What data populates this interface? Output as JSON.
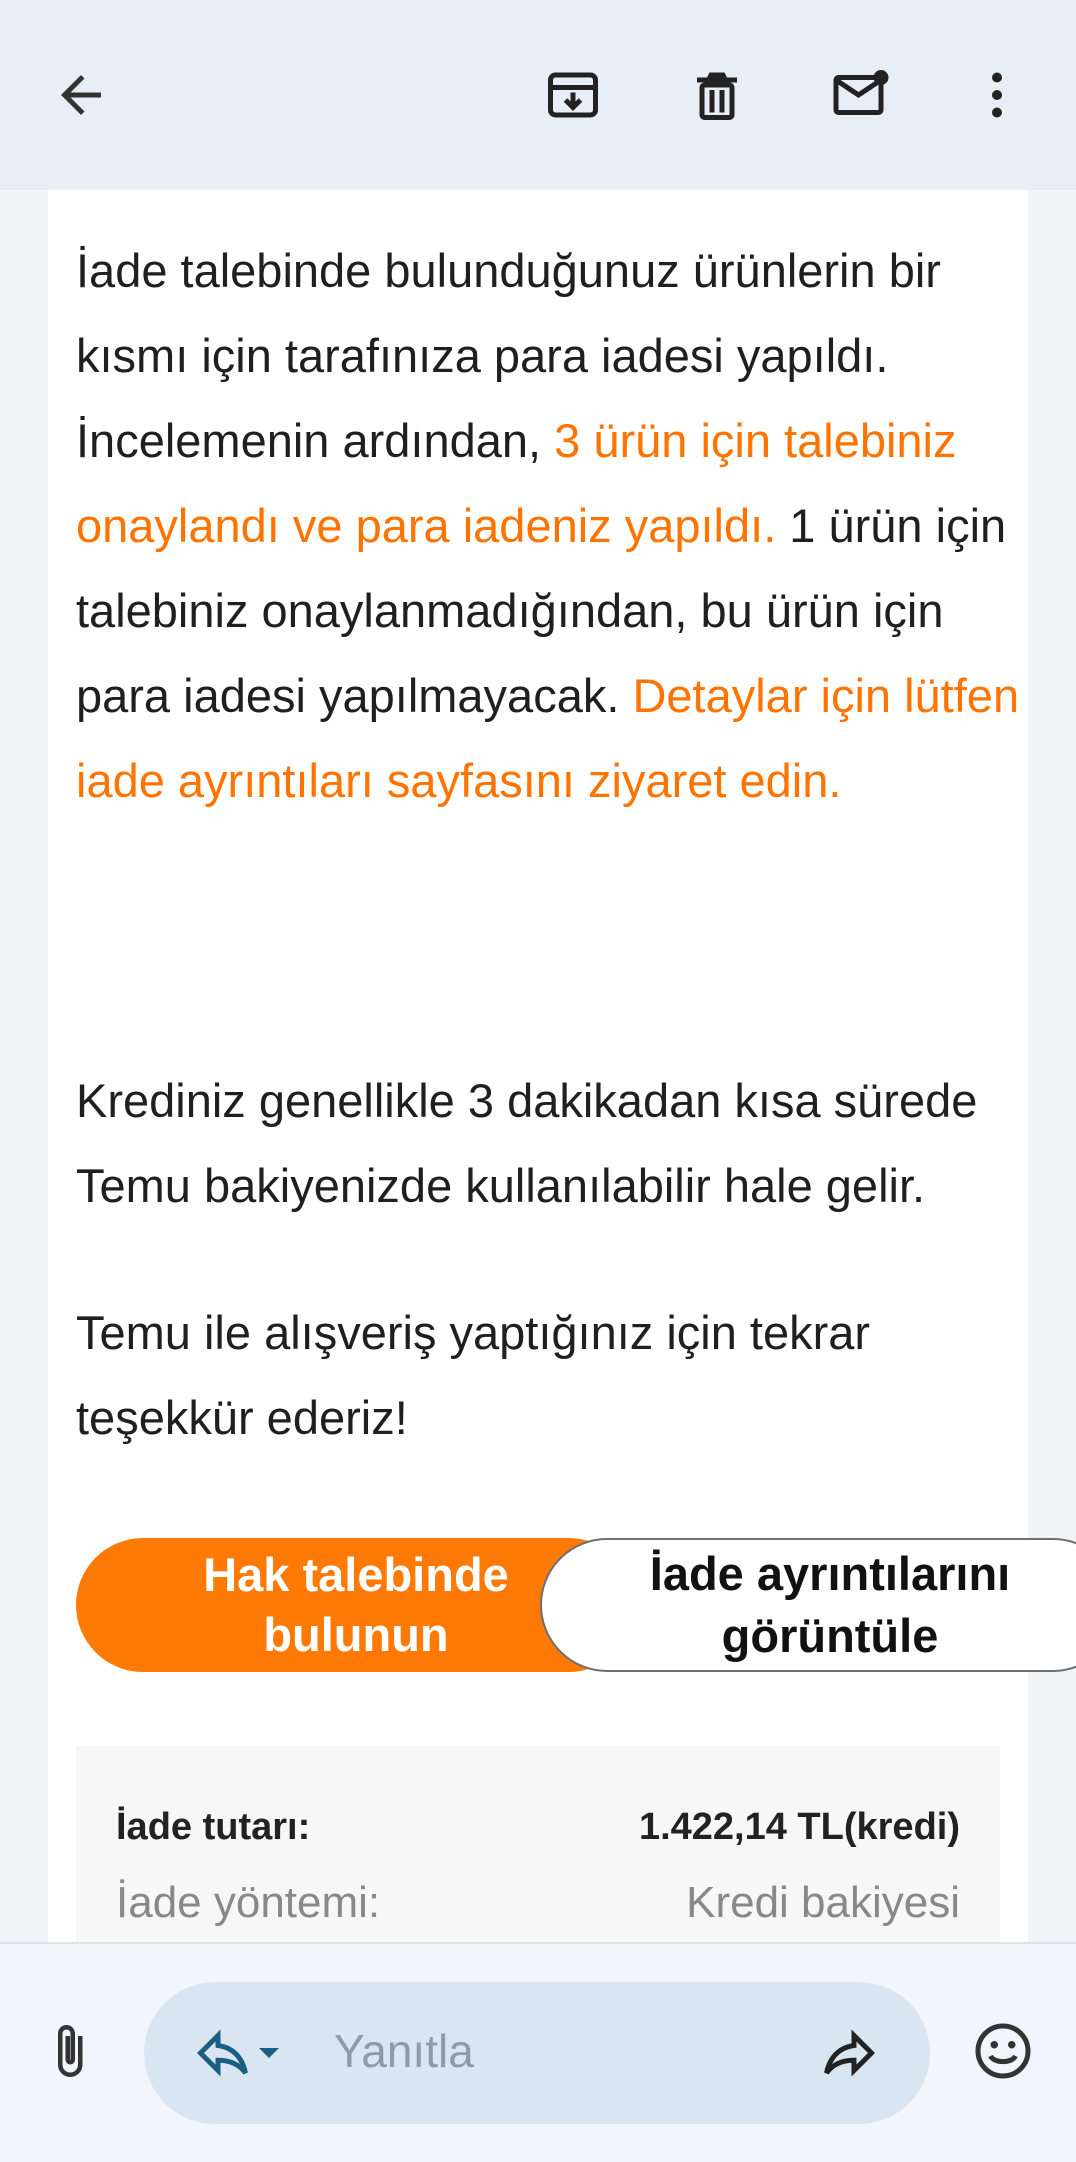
{
  "toolbar": {
    "back_icon": "arrow-left-icon",
    "archive_icon": "archive-icon",
    "delete_icon": "trash-icon",
    "mark_unread_icon": "mail-unread-icon",
    "more_icon": "more-vert-icon"
  },
  "email": {
    "paragraph1": {
      "part1": "İade talebinde bulunduğunuz ürünlerin bir kısmı için tarafınıza para iadesi yapıldı. İncelemenin ardından, ",
      "highlight1": "3 ürün için talebiniz onaylandı ve para iadeniz yapıldı.",
      "part2": " 1 ürün için talebiniz onaylanmadığından, bu ürün için para iadesi yapılmayacak. ",
      "highlight2": "Detaylar için lütfen iade ayrıntıları sayfasını ziyaret edin."
    },
    "paragraph2": "Krediniz genellikle 3 dakikadan kısa sürede Temu bakiyenizde kullanılabilir hale gelir.",
    "paragraph3": "Temu ile alışveriş yaptığınız için tekrar teşekkür ederiz!",
    "buttons": {
      "claim_label": "Hak talebinde bulunun",
      "details_label": "İade ayrıntılarını görüntüle"
    },
    "summary": {
      "amount_label": "İade tutarı:",
      "amount_value": "1.422,14 TL(kredi)",
      "method_label": "İade yöntemi:",
      "method_value": "Kredi bakiyesi"
    }
  },
  "bottom": {
    "reply_placeholder": "Yanıtla",
    "attach_icon": "paperclip-icon",
    "reply_icon": "reply-icon",
    "dropdown_icon": "dropdown-arrow-icon",
    "forward_icon": "forward-icon",
    "emoji_icon": "emoji-icon"
  },
  "colors": {
    "accent": "#ff7300",
    "header_bg": "#e8eef6",
    "reply_pill": "#d9e6f2"
  }
}
